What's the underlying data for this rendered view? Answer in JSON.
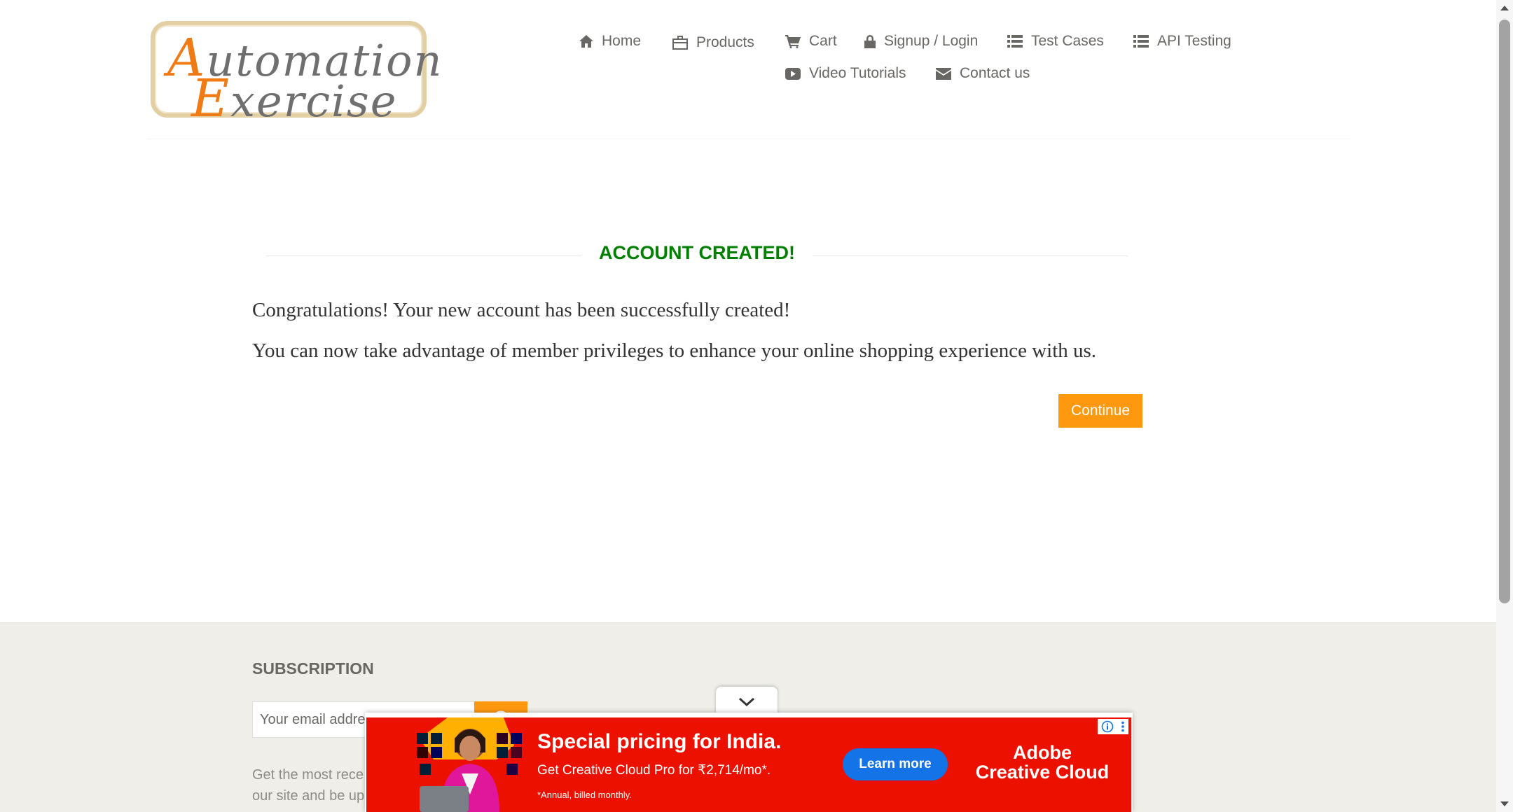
{
  "logo": {
    "line1_cap": "A",
    "line1_rest": "utomation",
    "line2_cap": "E",
    "line2_rest": "xercise"
  },
  "nav": {
    "items": [
      {
        "label": "Home",
        "icon": "home-icon"
      },
      {
        "label": "Products",
        "icon": "briefcase-icon"
      },
      {
        "label": "Cart",
        "icon": "cart-icon"
      },
      {
        "label": "Signup / Login",
        "icon": "lock-icon"
      },
      {
        "label": "Test Cases",
        "icon": "list-icon"
      },
      {
        "label": "API Testing",
        "icon": "list-icon"
      },
      {
        "label": "Video Tutorials",
        "icon": "youtube-play-icon"
      },
      {
        "label": "Contact us",
        "icon": "envelope-icon"
      }
    ]
  },
  "main": {
    "title": "ACCOUNT CREATED!",
    "message1": "Congratulations! Your new account has been successfully created!",
    "message2": "You can now take advantage of member privileges to enhance your online shopping experience with us.",
    "continue_label": "Continue"
  },
  "footer": {
    "subscription_title": "SUBSCRIPTION",
    "email_placeholder": "Your email addre",
    "note_line1": "Get the most rece",
    "note_line2": "our site and be up"
  },
  "ad": {
    "headline": "Special pricing for India.",
    "subline": "Get Creative Cloud Pro for ₹2,714/mo*.",
    "fine_print": "*Annual, billed monthly.",
    "cta": "Learn more",
    "brand_line1": "Adobe",
    "brand_line2": "Creative Cloud"
  },
  "colors": {
    "accent": "#fe980f",
    "success": "#008000",
    "ad_red": "#eb1000",
    "ad_button": "#1473e6"
  }
}
